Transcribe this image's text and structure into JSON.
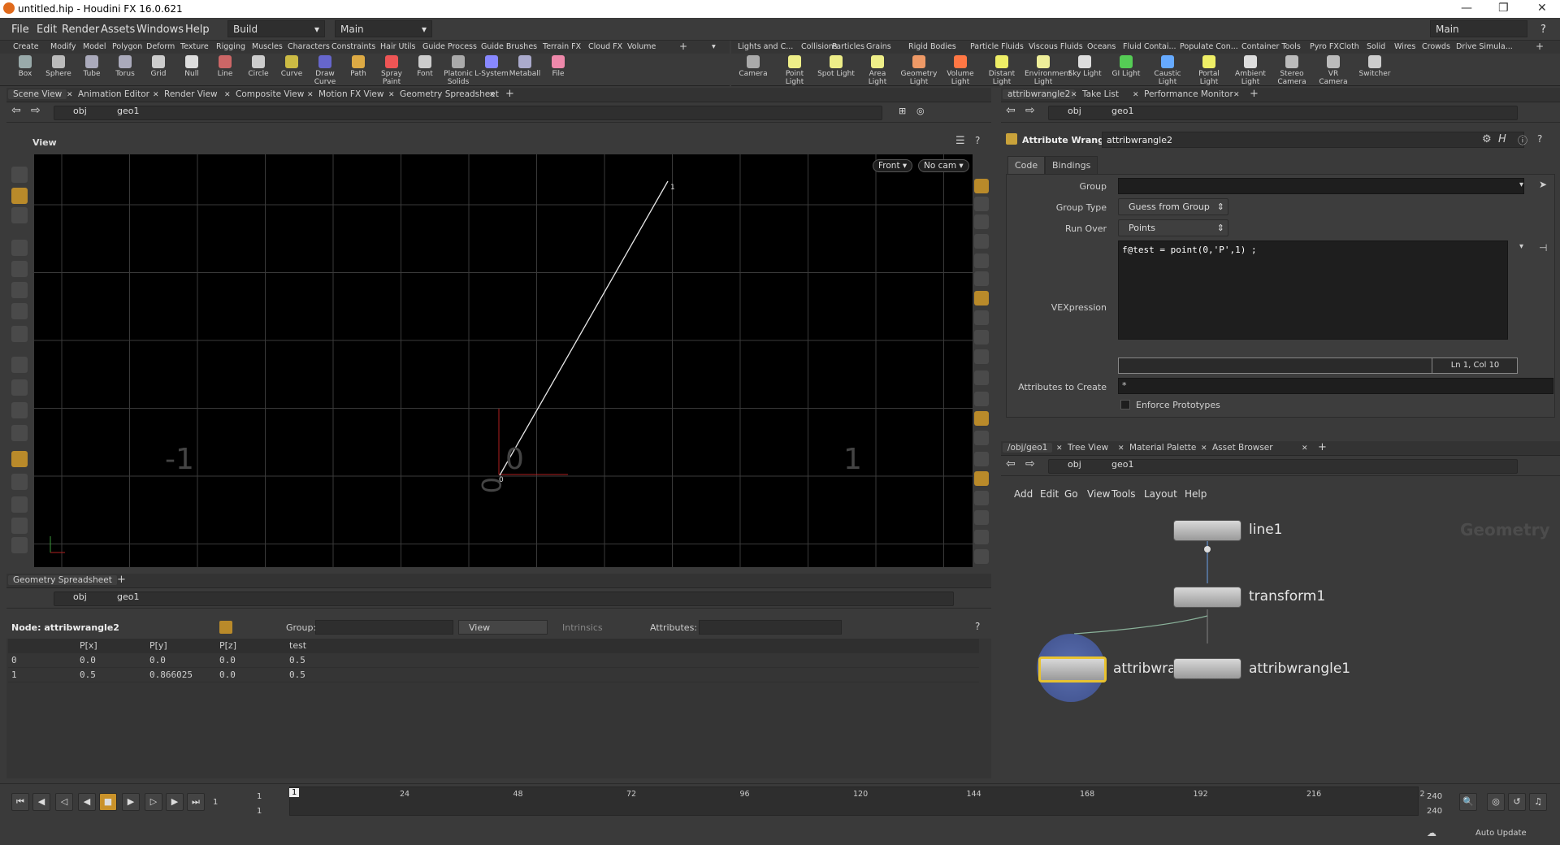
{
  "window": {
    "title": "untitled.hip - Houdini FX 16.0.621"
  },
  "menu": {
    "items": [
      "File",
      "Edit",
      "Render",
      "Assets",
      "Windows",
      "Help"
    ],
    "desktop": "Build",
    "context": "Main",
    "right_context": "Main"
  },
  "shelf_left": {
    "tabs": [
      "Create",
      "Modify",
      "Model",
      "Polygon",
      "Deform",
      "Texture",
      "Rigging",
      "Muscles",
      "Characters",
      "Constraints",
      "Hair Utils",
      "Guide Process",
      "Guide Brushes",
      "Terrain FX",
      "Cloud FX",
      "Volume"
    ],
    "tools": [
      "Box",
      "Sphere",
      "Tube",
      "Torus",
      "Grid",
      "Null",
      "Line",
      "Circle",
      "Curve",
      "Draw Curve",
      "Path",
      "Spray Paint",
      "Font",
      "Platonic Solids",
      "L-System",
      "Metaball",
      "File"
    ]
  },
  "shelf_right": {
    "tabs": [
      "Lights and C...",
      "Collisions",
      "Particles",
      "Grains",
      "Rigid Bodies",
      "Particle Fluids",
      "Viscous Fluids",
      "Oceans",
      "Fluid Contai...",
      "Populate Con...",
      "Container Tools",
      "Pyro FX",
      "Cloth",
      "Solid",
      "Wires",
      "Crowds",
      "Drive Simula..."
    ],
    "tools": [
      "Camera",
      "Point Light",
      "Spot Light",
      "Area Light",
      "Geometry Light",
      "Volume Light",
      "Distant Light",
      "Environment Light",
      "Sky Light",
      "GI Light",
      "Caustic Light",
      "Portal Light",
      "Ambient Light",
      "Stereo Camera",
      "VR Camera",
      "Switcher"
    ]
  },
  "scene_view": {
    "tabs": [
      "Scene View",
      "Animation Editor",
      "Render View",
      "Composite View",
      "Motion FX View",
      "Geometry Spreadsheet"
    ],
    "path": [
      "obj",
      "geo1"
    ],
    "view_label": "View",
    "front_btn": "Front",
    "cam_btn": "No cam",
    "grid_labels": {
      "left": "-1",
      "center": "0",
      "right": "1",
      "vertical": "0"
    },
    "point_labels": [
      "0",
      "1"
    ]
  },
  "params": {
    "tabs_top": [
      "attribwrangle2",
      "Take List",
      "Performance Monitor"
    ],
    "path": [
      "obj",
      "geo1"
    ],
    "node_type": "Attribute Wrangle",
    "node_name": "attribwrangle2",
    "subtabs": [
      "Code",
      "Bindings"
    ],
    "group_label": "Group",
    "group_type_label": "Group Type",
    "group_type_value": "Guess from Group",
    "run_over_label": "Run Over",
    "run_over_value": "Points",
    "vex_label": "VEXpression",
    "vex_code": "f@test = point(0,'P',1) ;",
    "cursor_pos": "Ln 1, Col 10",
    "attrs_label": "Attributes to Create",
    "attrs_value": "*",
    "enforce_label": "Enforce Prototypes"
  },
  "network": {
    "tabs_top": [
      "/obj/geo1",
      "Tree View",
      "Material Palette",
      "Asset Browser"
    ],
    "path": [
      "obj",
      "geo1"
    ],
    "menu": [
      "Add",
      "Edit",
      "Go",
      "View",
      "Tools",
      "Layout",
      "Help"
    ],
    "context_label": "Geometry",
    "nodes": [
      "line1",
      "transform1",
      "attribwra",
      "attribwrangle1"
    ]
  },
  "spreadsheet": {
    "tab": "Geometry Spreadsheet",
    "path": [
      "obj",
      "geo1"
    ],
    "node_label": "Node: attribwrangle2",
    "group_label": "Group:",
    "view_value": "View",
    "intrinsics": "Intrinsics",
    "attributes_label": "Attributes:",
    "columns": [
      "",
      "P[x]",
      "P[y]",
      "P[z]",
      "test"
    ],
    "rows": [
      [
        "0",
        "0.0",
        "0.0",
        "0.0",
        "0.5"
      ],
      [
        "1",
        "0.5",
        "0.866025",
        "0.0",
        "0.5"
      ]
    ]
  },
  "timeline": {
    "start": "1",
    "start2": "1",
    "current": "1",
    "ticks": [
      "24",
      "48",
      "72",
      "96",
      "120",
      "144",
      "168",
      "192",
      "216",
      "2"
    ],
    "end": "240",
    "end2": "240",
    "auto_update": "Auto Update"
  }
}
